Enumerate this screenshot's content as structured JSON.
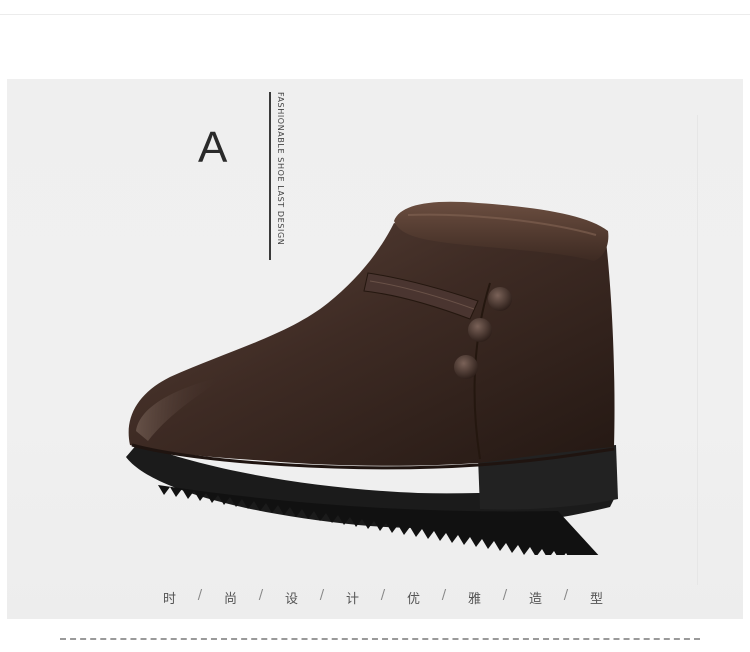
{
  "variant_letter": "A",
  "side_caption": "FASHIONABLE SHOE LAST DESIGN",
  "slogan": {
    "chars": [
      "时",
      "尚",
      "设",
      "计",
      "优",
      "雅",
      "造",
      "型"
    ],
    "separator": "/"
  },
  "product": {
    "icon": "ankle-boot-image",
    "color": "#3b2a22"
  }
}
